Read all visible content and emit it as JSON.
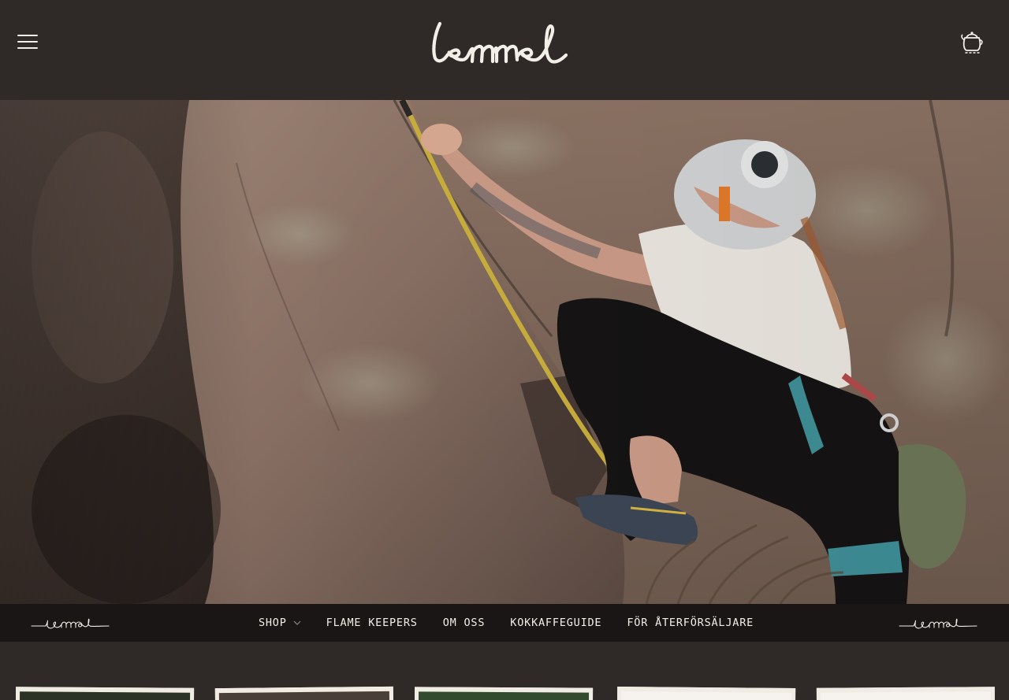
{
  "brand": {
    "name": "lemmel"
  },
  "header": {
    "menu_icon": "hamburger-menu-icon",
    "cart_icon": "kettle-cart-icon"
  },
  "hero": {
    "image_description_icon": "climber-hero-image",
    "colors": {
      "rock": "#8a7468",
      "shirt": "#e9e5de",
      "helmet": "#cfd1d2"
    }
  },
  "nav": {
    "items": [
      {
        "label": "SHOP",
        "has_dropdown": true
      },
      {
        "label": "FLAME KEEPERS"
      },
      {
        "label": "OM OSS"
      },
      {
        "label": "KOKKAFFEGUIDE"
      },
      {
        "label": "FÖR ÅTERFÖRSÄLJARE"
      }
    ]
  },
  "colors": {
    "header_bg": "#2f2a28",
    "nav_bg": "#1a1615",
    "text": "#f2efe9",
    "card_border": "#f1ece3"
  }
}
